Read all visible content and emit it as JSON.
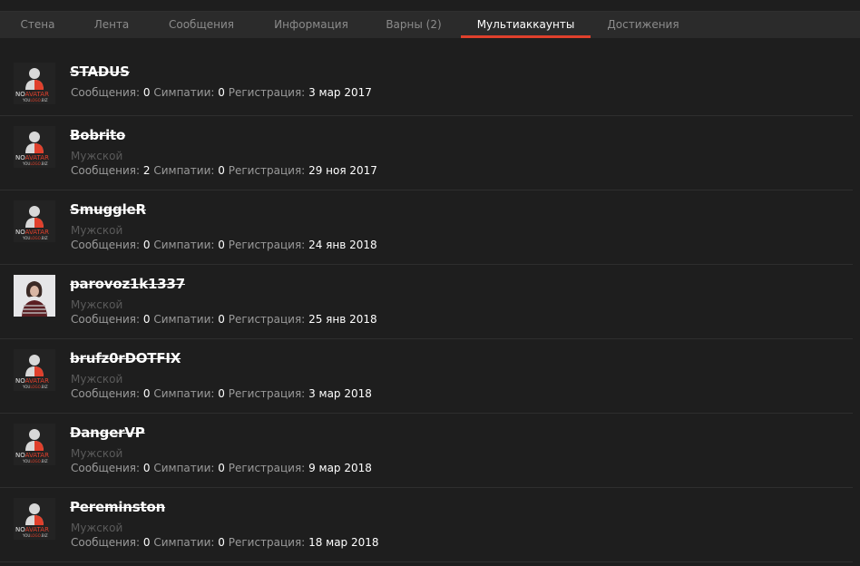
{
  "tabs": [
    {
      "label": "Стена",
      "active": false
    },
    {
      "label": "Лента",
      "active": false
    },
    {
      "label": "Сообщения",
      "active": false
    },
    {
      "label": "Информация",
      "active": false
    },
    {
      "label": "Варны (2)",
      "active": false
    },
    {
      "label": "Мультиаккаунты",
      "active": true
    },
    {
      "label": "Достижения",
      "active": false
    }
  ],
  "labels": {
    "messages": "Сообщения:",
    "likes": "Симпатии:",
    "registered": "Регистрация:"
  },
  "avatar_text": {
    "main_a": "NO",
    "main_b": "AVATAR",
    "sub_a": "YOU",
    "sub_b": "LOGO",
    "sub_c": ".BIZ"
  },
  "colors": {
    "accent": "#e0402c",
    "background": "#1e1e1e",
    "tabbar": "#2b2b2b"
  },
  "accounts": [
    {
      "username": "STADUS",
      "gender": "",
      "messages": "0",
      "likes": "0",
      "registered": "3 мар 2017",
      "avatar": "no-avatar-icon"
    },
    {
      "username": "Bobrito",
      "gender": "Мужской",
      "messages": "2",
      "likes": "0",
      "registered": "29 ноя 2017",
      "avatar": "no-avatar-icon"
    },
    {
      "username": "SmuggleR",
      "gender": "Мужской",
      "messages": "0",
      "likes": "0",
      "registered": "24 янв 2018",
      "avatar": "no-avatar-icon"
    },
    {
      "username": "parovoz1k1337",
      "gender": "Мужской",
      "messages": "0",
      "likes": "0",
      "registered": "25 янв 2018",
      "avatar": "photo-avatar"
    },
    {
      "username": "brufz0rDOTFIX",
      "gender": "Мужской",
      "messages": "0",
      "likes": "0",
      "registered": "3 мар 2018",
      "avatar": "no-avatar-icon"
    },
    {
      "username": "DangerVP",
      "gender": "Мужской",
      "messages": "0",
      "likes": "0",
      "registered": "9 мар 2018",
      "avatar": "no-avatar-icon"
    },
    {
      "username": "Pereminston",
      "gender": "Мужской",
      "messages": "0",
      "likes": "0",
      "registered": "18 мар 2018",
      "avatar": "no-avatar-icon"
    }
  ]
}
